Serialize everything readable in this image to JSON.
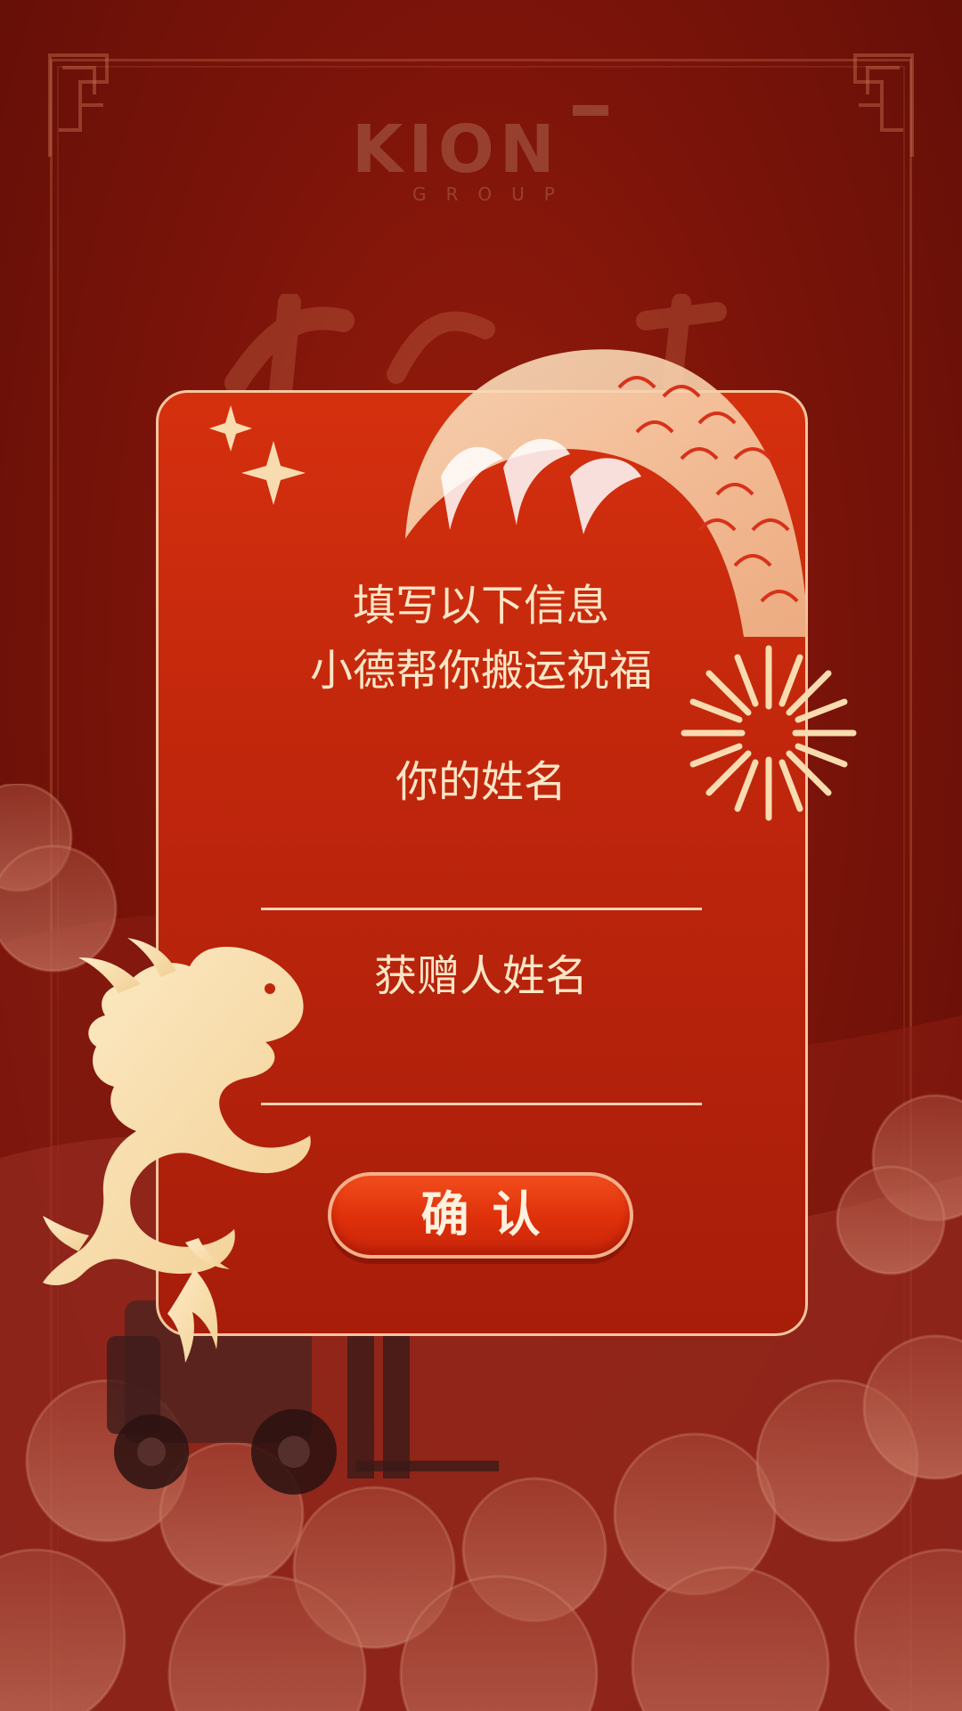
{
  "brand": {
    "logo_name": "KION",
    "logo_sub": "GROUP"
  },
  "form": {
    "heading_line1": "填写以下信息",
    "heading_line2": "小德帮你搬运祝福",
    "your_name_label": "你的姓名",
    "your_name_value": "",
    "recipient_name_label": "获赠人姓名",
    "recipient_name_value": "",
    "confirm_label": "确认"
  },
  "colors": {
    "background": "#7c140a",
    "card": "#c0260c",
    "card_border": "#f3c6a0",
    "text": "#fbe6c6",
    "button": "#de2f0a",
    "gold": "#f6dcaa"
  },
  "icons": [
    "sparkle-icon",
    "firework-icon",
    "dragon-icon",
    "dragon-claw-icon",
    "cloud-icon",
    "forklift-icon"
  ]
}
